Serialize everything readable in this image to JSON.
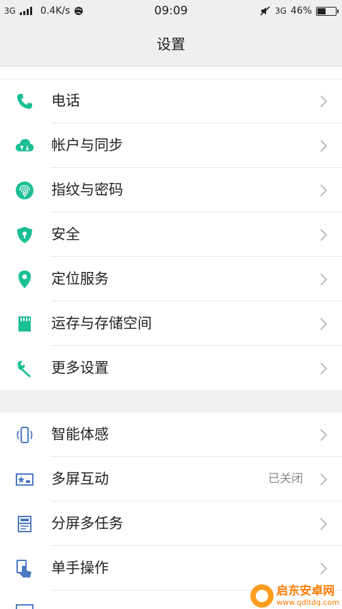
{
  "status_bar": {
    "network": "3G",
    "speed": "0.4K/s",
    "time": "09:09",
    "network_right": "3G",
    "battery_percent": "46%",
    "battery_level": 0.46
  },
  "header": {
    "title": "设置"
  },
  "section1": [
    {
      "label": "电话",
      "icon": "phone-icon"
    },
    {
      "label": "帐户与同步",
      "icon": "cloud-sync-icon"
    },
    {
      "label": "指纹与密码",
      "icon": "fingerprint-icon"
    },
    {
      "label": "安全",
      "icon": "shield-lock-icon"
    },
    {
      "label": "定位服务",
      "icon": "location-pin-icon"
    },
    {
      "label": "运存与存储空间",
      "icon": "sd-card-icon"
    },
    {
      "label": "更多设置",
      "icon": "wrench-icon"
    }
  ],
  "section2": [
    {
      "label": "智能体感",
      "icon": "phone-motion-icon"
    },
    {
      "label": "多屏互动",
      "icon": "multiscreen-icon",
      "value": "已关闭"
    },
    {
      "label": "分屏多任务",
      "icon": "split-screen-icon"
    },
    {
      "label": "单手操作",
      "icon": "one-hand-icon"
    }
  ],
  "watermark": {
    "name": "启东安卓网",
    "url": "www.qdltdq.com"
  },
  "colors": {
    "teal": "#1bbf93",
    "blue": "#4a78c2",
    "header_bg": "#efefef"
  }
}
